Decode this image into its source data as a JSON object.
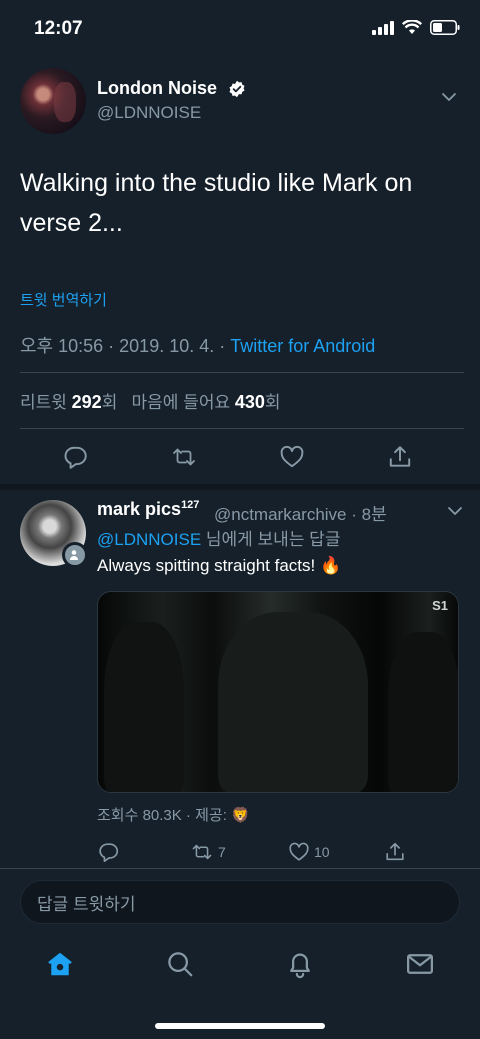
{
  "status": {
    "time": "12:07"
  },
  "tweet": {
    "author_name": "London Noise",
    "author_handle": "@LDNNOISE",
    "text": "Walking into the studio like Mark on verse 2...",
    "translate_label": "트윗 번역하기",
    "meta_time": "오후 10:56 · 2019. 10. 4. · ",
    "client": "Twitter for Android",
    "retweets_label": "리트윗",
    "retweets_count": "292",
    "retweets_suffix": "회",
    "likes_label": "마음에 들어요",
    "likes_count": "430",
    "likes_suffix": "회"
  },
  "reply": {
    "author_name": "mark pics",
    "author_sup": "127",
    "author_handle": "@nctmarkarchive · 8분",
    "reply_to_mention": "@LDNNOISE",
    "reply_to_suffix": " 님에게 보내는 답글",
    "text": "Always spitting straight facts! 🔥",
    "media_badge": "S1",
    "views": "조회수 80.3K · 제공: 🦁",
    "retweet_count": "7",
    "like_count": "10"
  },
  "compose": {
    "placeholder": "답글 트윗하기"
  },
  "colors": {
    "background": "#15202b",
    "accent": "#1da1f2",
    "muted": "#8899a6"
  },
  "icons": [
    "home-icon",
    "search-icon",
    "bell-icon",
    "mail-icon",
    "reply-icon",
    "retweet-icon",
    "heart-icon",
    "share-icon",
    "verified-icon",
    "chevron-down-icon"
  ]
}
